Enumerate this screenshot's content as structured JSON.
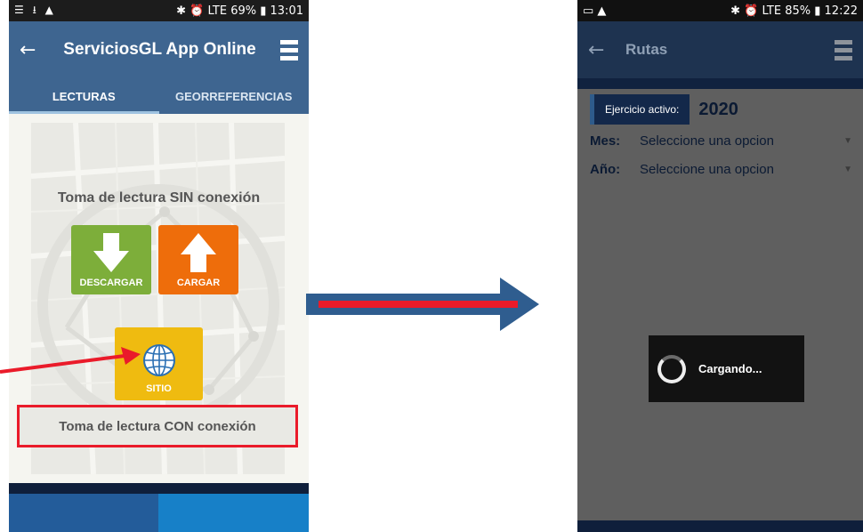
{
  "left_phone": {
    "status_bar": {
      "left_icons": "☰ ⭳ ▲",
      "right_text": "✱ ⏰ LTE 69% ▮ 13:01"
    },
    "toolbar": {
      "back_glyph": "←",
      "title": "ServiciosGL App Online"
    },
    "tabs": [
      {
        "label": "LECTURAS",
        "active": true
      },
      {
        "label": "GEORREFERENCIAS",
        "active": false
      }
    ],
    "offline_label": "Toma de lectura SIN conexión",
    "buttons": {
      "download": "DESCARGAR",
      "upload": "CARGAR",
      "site": "SITIO"
    },
    "online_label": "Toma de lectura CON conexión"
  },
  "right_phone": {
    "status_bar": {
      "left_icons": "▭ ▲",
      "right_text": "✱ ⏰ LTE 85% ▮ 12:22"
    },
    "toolbar": {
      "back_glyph": "←",
      "title": "Rutas"
    },
    "active_exercise_label": "Ejercicio activo:",
    "active_exercise_year": "2020",
    "month": {
      "label": "Mes:",
      "value": "Seleccione una opcion"
    },
    "year": {
      "label": "Año:",
      "value": "Seleccione una opcion"
    },
    "loading_text": "Cargando..."
  },
  "colors": {
    "header_blue": "#3e6590",
    "download_green": "#7dae3a",
    "upload_orange": "#ee6d0b",
    "site_yellow": "#efbb10",
    "highlight_red": "#ea1b2a"
  }
}
